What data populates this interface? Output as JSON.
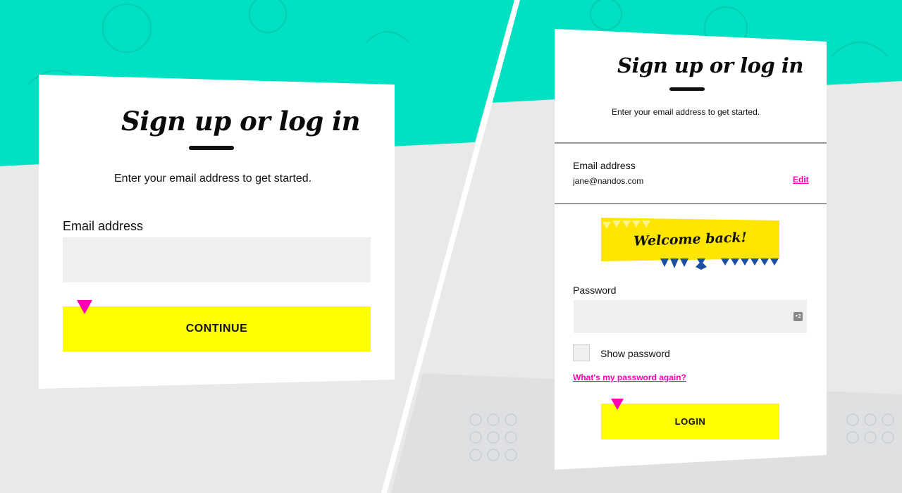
{
  "left_panel": {
    "title": "Sign up or log in",
    "subtitle": "Enter your email address to get started.",
    "email_label": "Email address",
    "email_value": "",
    "email_placeholder": "",
    "continue_label": "CONTINUE"
  },
  "right_panel": {
    "title": "Sign up or log in",
    "subtitle": "Enter your email address to get started.",
    "email_label": "Email address",
    "email_value": "jane@nandos.com",
    "edit_label": "Edit",
    "welcome_banner": "Welcome back!",
    "password_label": "Password",
    "password_value": "",
    "password_manager_icon": "key-icon",
    "show_password_label": "Show password",
    "show_password_checked": false,
    "forgot_password_label": "What's my password again?",
    "login_label": "LOGIN"
  },
  "colors": {
    "teal": "#00e0c3",
    "grey_bg": "#e9e9e9",
    "yellow": "#ffff00",
    "pink": "#ff00b4",
    "banner_yellow": "#ffe600",
    "banner_blue": "#1b4fa0"
  }
}
